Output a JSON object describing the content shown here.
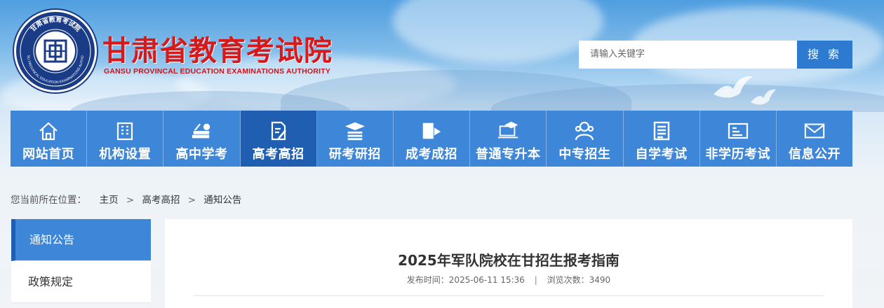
{
  "header": {
    "title": "甘肃省教育考试院",
    "subtitle": "GANSU PROVINCAL EDUCATION EXAMINATIONS AUTHORITY",
    "seal_text_top": "甘肃省教育考试院",
    "seal_text_ring": "GANSU PROVINCAL EDUCATION EXAMINATIONS AUTHORITY",
    "brand_color": "#d7191c",
    "seal_color": "#1a3b86"
  },
  "search": {
    "placeholder": "请输入关键字",
    "button_label": "搜 索"
  },
  "nav": {
    "items": [
      {
        "label": "网站首页",
        "icon": "home-icon"
      },
      {
        "label": "机构设置",
        "icon": "building-icon"
      },
      {
        "label": "高中学考",
        "icon": "books-apple-icon"
      },
      {
        "label": "高考高招",
        "icon": "document-pen-icon",
        "active": true
      },
      {
        "label": "研考研招",
        "icon": "graduation-cap-icon"
      },
      {
        "label": "成考成招",
        "icon": "book-arrow-icon"
      },
      {
        "label": "普通专升本",
        "icon": "laptop-cap-icon"
      },
      {
        "label": "中专招生",
        "icon": "users-icon"
      },
      {
        "label": "自学考试",
        "icon": "list-doc-icon"
      },
      {
        "label": "非学历考试",
        "icon": "id-card-icon"
      },
      {
        "label": "信息公开",
        "icon": "envelope-icon"
      }
    ],
    "bg_color": "#3e86d8",
    "active_color": "#1f5eb1"
  },
  "breadcrumb": {
    "prefix": "您当前所在位置：",
    "items": [
      "主页",
      "高考高招",
      "通知公告"
    ],
    "separator": ">"
  },
  "sidebar": {
    "items": [
      {
        "label": "通知公告",
        "active": true
      },
      {
        "label": "政策规定"
      }
    ]
  },
  "article": {
    "title": "2025年军队院校在甘招生报考指南",
    "publish_label": "发布时间：",
    "publish_time": "2025-06-11 15:36",
    "meta_divider": "|",
    "views_label": "浏览次数：",
    "views": "3490"
  }
}
